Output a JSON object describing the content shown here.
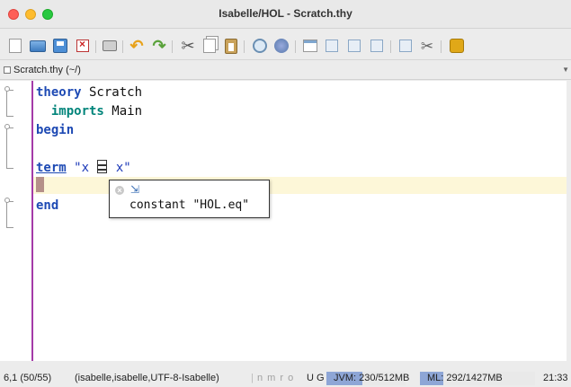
{
  "window": {
    "title": "Isabelle/HOL - Scratch.thy"
  },
  "toolbar": {
    "buttons": [
      "new-file",
      "open-file",
      "save-file",
      "close-file",
      "print",
      "undo",
      "redo",
      "cut",
      "copy",
      "paste",
      "find",
      "find-next",
      "new-view",
      "unsplit",
      "split-horizontal",
      "split-vertical",
      "buffer-options",
      "global-options",
      "plugin-manager"
    ]
  },
  "buffer": {
    "tab_label": "Scratch.thy (~/)"
  },
  "editor": {
    "lines": {
      "l1_kw": "theory",
      "l1_name": " Scratch",
      "l2_kw": "imports",
      "l2_name": " Main",
      "l3_kw": "begin",
      "l5_kw": "term",
      "l5_open": " \"x ",
      "l5_close": " x\"",
      "l7_kw": "end"
    },
    "tooltip": {
      "text": "constant \"HOL.eq\""
    }
  },
  "status": {
    "position": "6,1 (50/55)",
    "mode": "(isabelle,isabelle,UTF-8-Isabelle)",
    "flags": "n m r o",
    "ug": "U G",
    "jvm_label": "JVM: 230/512MB",
    "ml_label": "ML: 292/1427MB",
    "time": "21:33",
    "jvm_fraction": 0.45,
    "ml_fraction": 0.2
  },
  "colors": {
    "accent": "#a43aa8",
    "keyword": "#1e4ab4",
    "string": "#1c39b8",
    "cursorline": "#fdf7d8"
  }
}
